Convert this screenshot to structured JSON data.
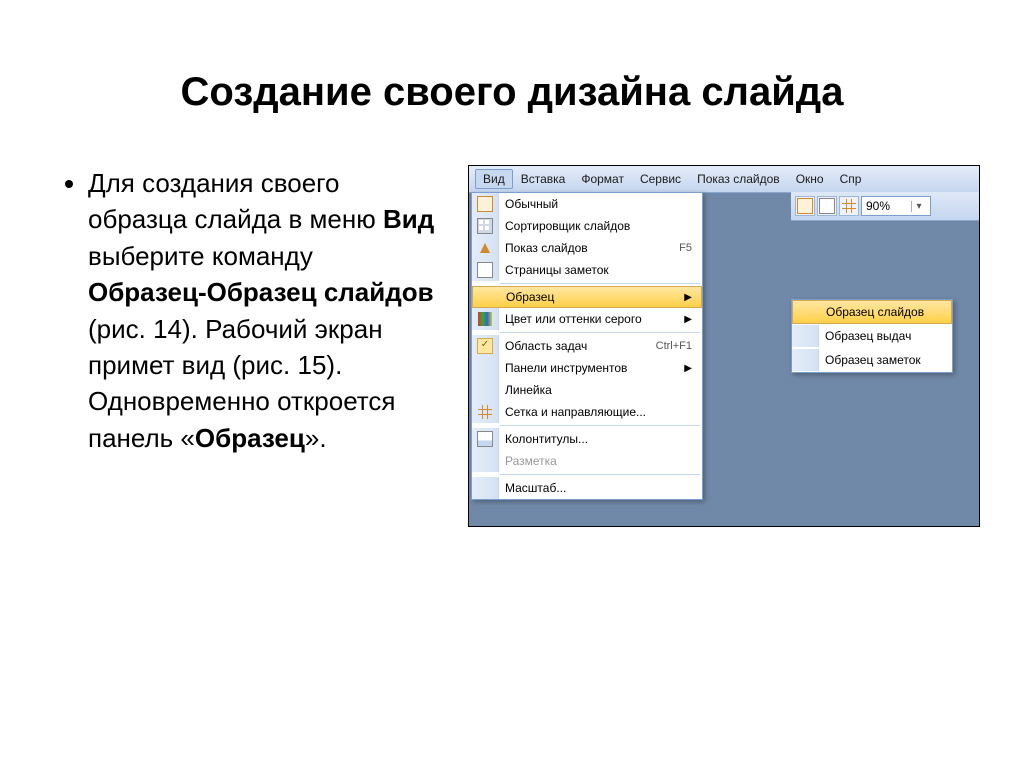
{
  "title": "Создание своего дизайна слайда",
  "bullet": {
    "pre": "Для создания своего образца слайда в меню ",
    "bold1": "Вид",
    "mid1": " выберите команду ",
    "bold2": "Образец-Образец слайдов",
    "mid2": " (рис. 14). Рабочий экран примет вид (рис. 15). Одновременно откроется панель «",
    "bold3": "Образец",
    "post": "»."
  },
  "menubar": {
    "items": [
      "Вид",
      "Вставка",
      "Формат",
      "Сервис",
      "Показ слайдов",
      "Окно",
      "Спр"
    ]
  },
  "toolbar": {
    "zoom": "90%"
  },
  "dropdown": {
    "item0": {
      "label": "Обычный"
    },
    "item1": {
      "label": "Сортировщик слайдов"
    },
    "item2": {
      "label": "Показ слайдов",
      "shortcut": "F5"
    },
    "item3": {
      "label": "Страницы заметок"
    },
    "item4": {
      "label": "Образец"
    },
    "item5": {
      "label": "Цвет или оттенки серого"
    },
    "item6": {
      "label": "Область задач",
      "shortcut": "Ctrl+F1"
    },
    "item7": {
      "label": "Панели инструментов"
    },
    "item8": {
      "label": "Линейка"
    },
    "item9": {
      "label": "Сетка и направляющие..."
    },
    "item10": {
      "label": "Колонтитулы..."
    },
    "item11": {
      "label": "Разметка"
    },
    "item12": {
      "label": "Масштаб..."
    }
  },
  "submenu": {
    "item0": {
      "label": "Образец слайдов"
    },
    "item1": {
      "label": "Образец выдач"
    },
    "item2": {
      "label": "Образец заметок"
    }
  }
}
